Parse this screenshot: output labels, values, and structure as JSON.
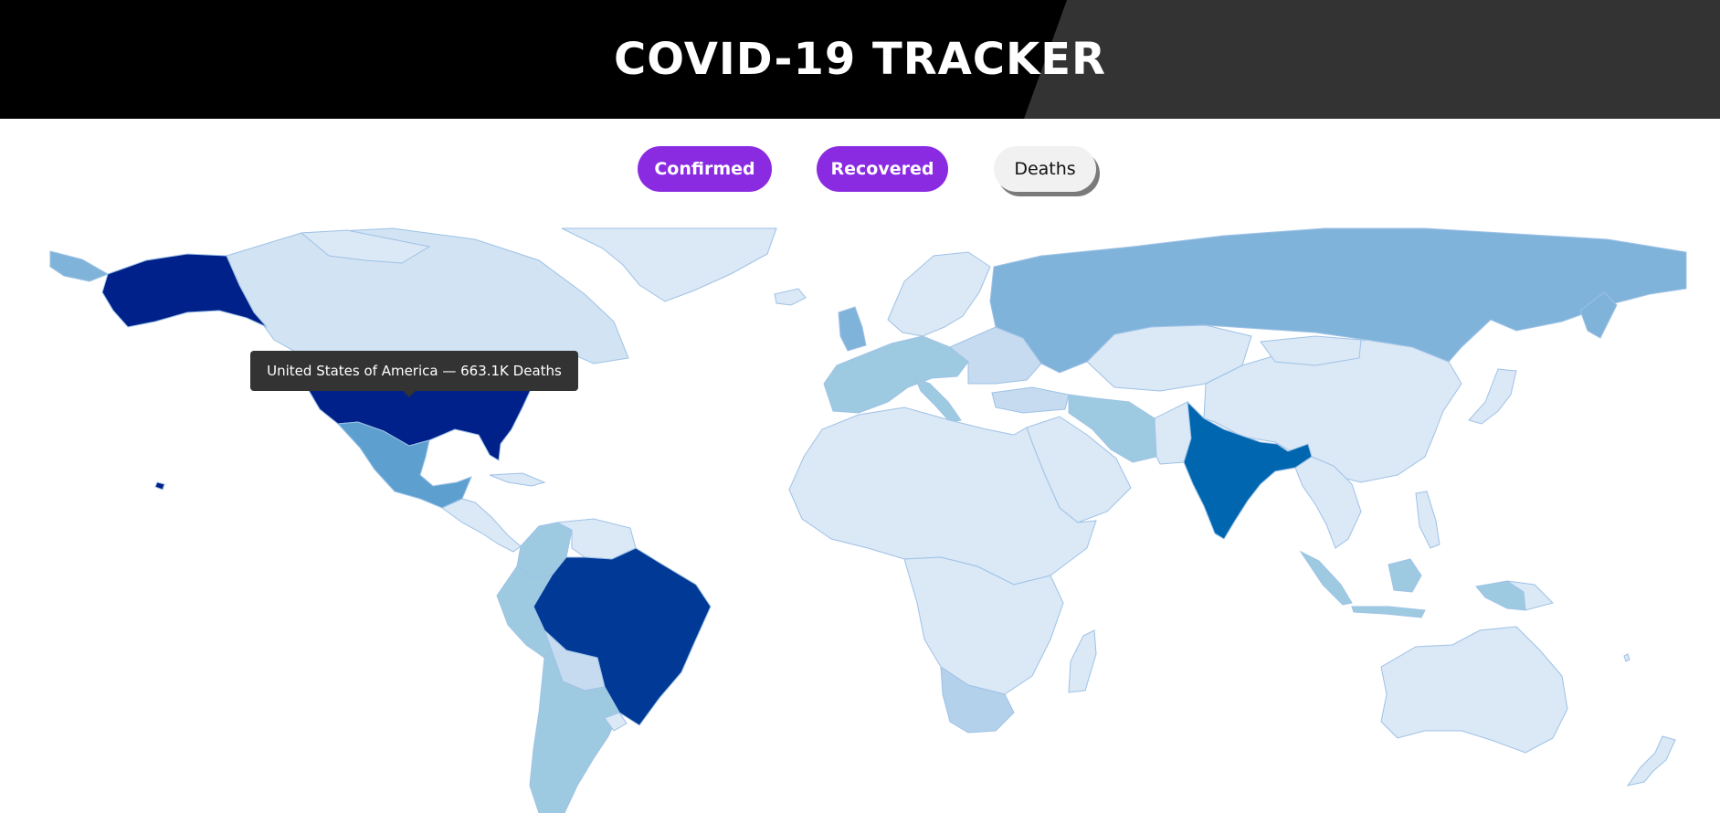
{
  "header": {
    "title": "COVID-19 TRACKER"
  },
  "metrics": {
    "confirmed_label": "Confirmed",
    "recovered_label": "Recovered",
    "deaths_label": "Deaths",
    "selected": "Deaths"
  },
  "tooltip": {
    "text": "United States of America — 663.1K Deaths"
  },
  "colors": {
    "header_bg": "#000000",
    "header_accent": "#333333",
    "button_active": "#8a2be2",
    "button_selected": "#f1f1f1",
    "scale_lowest": "#dbe8f6",
    "scale_low": "#c6dbef",
    "scale_mid_low": "#9ecae1",
    "scale_mid": "#6baed6",
    "scale_mid_high": "#4292c6",
    "scale_high": "#0066b0",
    "scale_very_high": "#003a96",
    "scale_max": "#00208a",
    "tooltip_bg": "#333333"
  },
  "map": {
    "countries": [
      {
        "name": "United States of America",
        "color": "#00208a"
      },
      {
        "name": "Canada",
        "color": "#d2e3f3"
      },
      {
        "name": "Greenland",
        "color": "#dbe8f6"
      },
      {
        "name": "Mexico",
        "color": "#5da0d0"
      },
      {
        "name": "Brazil",
        "color": "#003a96"
      },
      {
        "name": "Peru",
        "color": "#9ecae1"
      },
      {
        "name": "Colombia",
        "color": "#9ecae1"
      },
      {
        "name": "Argentina",
        "color": "#9ecae1"
      },
      {
        "name": "Russia",
        "color": "#80b3da"
      },
      {
        "name": "India",
        "color": "#0066b0"
      },
      {
        "name": "Iran",
        "color": "#9ecae1"
      },
      {
        "name": "Indonesia",
        "color": "#9ecae1"
      },
      {
        "name": "South Africa",
        "color": "#b3d1eb"
      },
      {
        "name": "United Kingdom",
        "color": "#80b3da"
      },
      {
        "name": "China",
        "color": "#dbe8f6"
      },
      {
        "name": "Australia",
        "color": "#dbe8f6"
      }
    ]
  }
}
